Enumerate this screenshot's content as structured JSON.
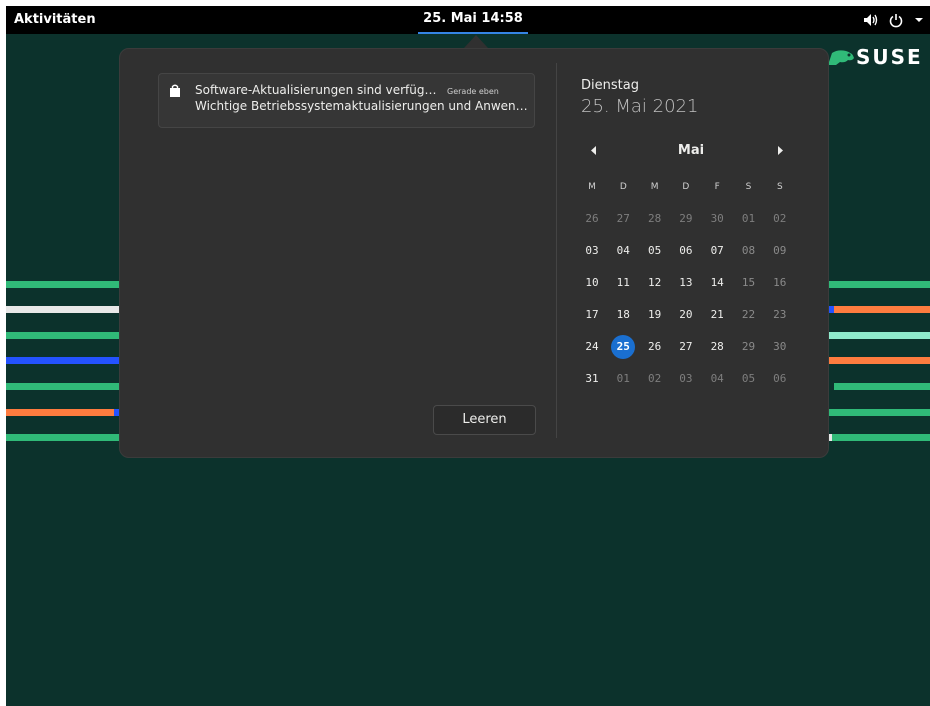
{
  "topbar": {
    "activities": "Aktivitäten",
    "clock": "25. Mai 14:58"
  },
  "desktop": {
    "logo_text": "SUSE"
  },
  "notification": {
    "title": "Software-Aktualisierungen sind verfüg…",
    "time": "Gerade eben",
    "body": "Wichtige Betriebssystemaktualisierungen und Anwen…"
  },
  "clear_label": "Leeren",
  "calendar": {
    "weekday": "Dienstag",
    "full_date": "25. Mai 2021",
    "month": "Mai",
    "day_headers": [
      "M",
      "D",
      "M",
      "D",
      "F",
      "S",
      "S"
    ],
    "weeks": [
      [
        "26",
        "27",
        "28",
        "29",
        "30",
        "01",
        "02"
      ],
      [
        "03",
        "04",
        "05",
        "06",
        "07",
        "08",
        "09"
      ],
      [
        "10",
        "11",
        "12",
        "13",
        "14",
        "15",
        "16"
      ],
      [
        "17",
        "18",
        "19",
        "20",
        "21",
        "22",
        "23"
      ],
      [
        "24",
        "25",
        "26",
        "27",
        "28",
        "29",
        "30"
      ],
      [
        "31",
        "01",
        "02",
        "03",
        "04",
        "05",
        "06"
      ]
    ],
    "today": "25"
  },
  "colors": {
    "background": "#0c322c",
    "accent": "#1a6fd0",
    "suse_green": "#30ba78"
  }
}
